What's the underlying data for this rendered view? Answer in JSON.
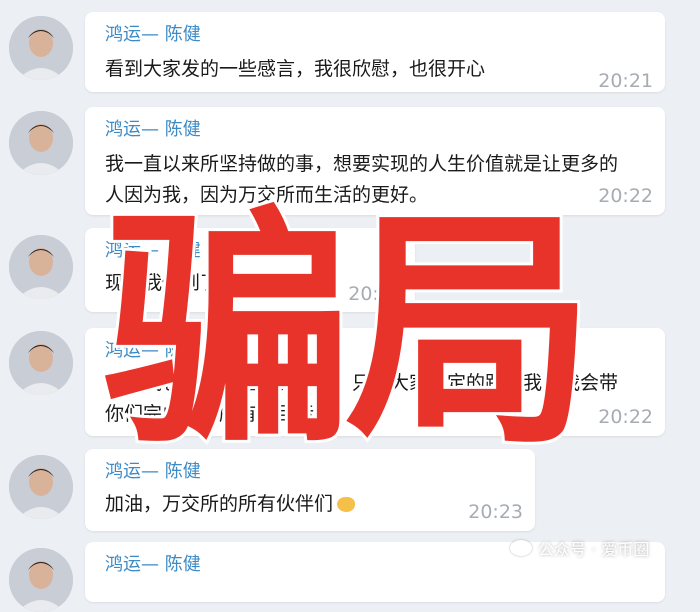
{
  "messages": [
    {
      "sender": "鸿运— 陈健",
      "lines": [
        "看到大家发的一些感言，我很欣慰，也很开心"
      ],
      "time": "20:21"
    },
    {
      "sender": "鸿运— 陈健",
      "lines": [
        "我一直以来所坚持做的事，想要实现的人生价值就是让更多的",
        "人因为我，因为万交所而生活的更好。"
      ],
      "time": "20:22"
    },
    {
      "sender": "鸿运— 陈健",
      "lines": [
        "现在我做到了"
      ],
      "time": "20:22",
      "emoji": "fire-emoji"
    },
    {
      "sender": "鸿运— 陈健",
      "lines": [
        "未来我也会一直坚持做下去，只要大家坚定的跟着我，我会带",
        "你们完成你们所有的目标"
      ],
      "time": "20:22",
      "emoji": "fire-emoji"
    },
    {
      "sender": "鸿运— 陈健",
      "lines": [
        "加油，万交所的所有伙伴们"
      ],
      "time": "20:23",
      "emoji": "fist-emoji"
    },
    {
      "sender": "鸿运— 陈健",
      "lines": [],
      "time": ""
    }
  ],
  "overlay": {
    "text": "骗局",
    "color": "#e8332a"
  },
  "watermark": {
    "text": "公众号 · 爱币圈",
    "icon": "wechat-icon"
  }
}
